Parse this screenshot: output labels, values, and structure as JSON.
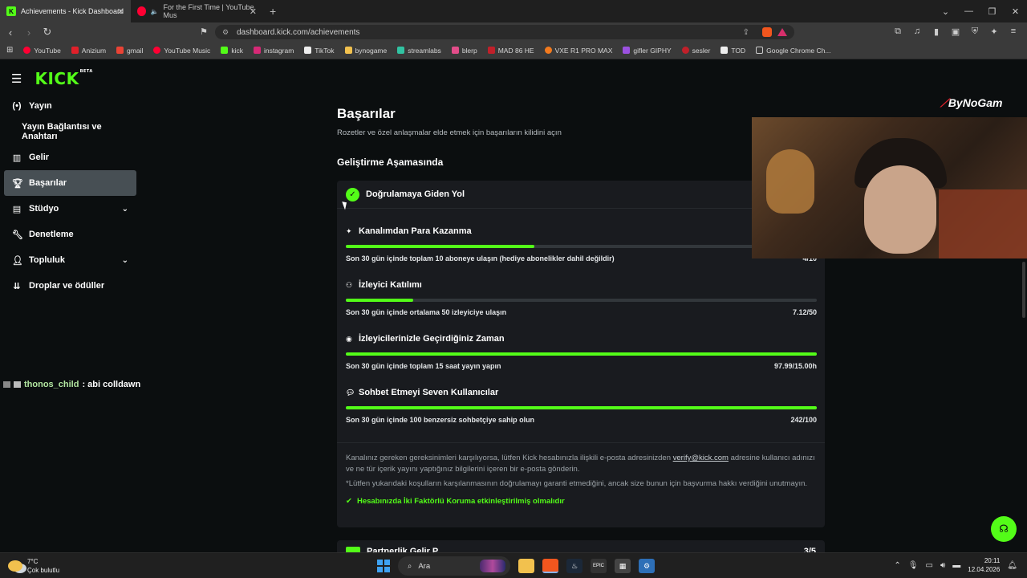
{
  "browser": {
    "tabs": [
      {
        "title": "Achievements - Kick Dashboard",
        "active": true
      },
      {
        "title": "For the First Time | YouTube Mus",
        "active": false
      }
    ],
    "new_tab": "+",
    "url": "dashboard.kick.com/achievements",
    "bookmarks": [
      {
        "label": "YouTube",
        "color": "#ff0033"
      },
      {
        "label": "Anizium",
        "color": "#e0202a"
      },
      {
        "label": "gmail",
        "color": "#ea4335"
      },
      {
        "label": "YouTube Music",
        "color": "#ff0033"
      },
      {
        "label": "kick",
        "color": "#53fc18"
      },
      {
        "label": "instagram",
        "color": "#d62976"
      },
      {
        "label": "TikTok",
        "color": "#ffffff"
      },
      {
        "label": "bynogame",
        "color": "#f2c14e"
      },
      {
        "label": "streamlabs",
        "color": "#31c3a2"
      },
      {
        "label": "blerp",
        "color": "#e34d8a"
      },
      {
        "label": "MAD 86 HE",
        "color": "#c0202a"
      },
      {
        "label": "VXE R1 PRO MAX",
        "color": "#f27a1e"
      },
      {
        "label": "gifler GIPHY",
        "color": "#9b51e0"
      },
      {
        "label": "sesler",
        "color": "#c0202a"
      },
      {
        "label": "TOD",
        "color": "#ffffff"
      },
      {
        "label": "Google Chrome Ch...",
        "color": "#888888"
      }
    ]
  },
  "kick": {
    "logo": "KICK",
    "logo_sup": "BETA",
    "accent": "#53fc18"
  },
  "sidebar": {
    "items": [
      {
        "label": "Yayın",
        "icon": "broadcast-icon",
        "type": "main"
      },
      {
        "label": "Yayın Bağlantısı ve Anahtarı",
        "icon": "",
        "type": "sub"
      },
      {
        "label": "Gelir",
        "icon": "revenue-icon",
        "type": "main"
      },
      {
        "label": "Başarılar",
        "icon": "trophy-icon",
        "type": "main",
        "active": true
      },
      {
        "label": "Stüdyo",
        "icon": "studio-icon",
        "type": "main",
        "expandable": true
      },
      {
        "label": "Denetleme",
        "icon": "wrench-icon",
        "type": "main"
      },
      {
        "label": "Topluluk",
        "icon": "community-icon",
        "type": "main",
        "expandable": true
      },
      {
        "label": "Droplar ve ödüller",
        "icon": "drops-icon",
        "type": "main"
      }
    ]
  },
  "chat_overlay": {
    "user": "thonos_child",
    "message": " : abi colldawn"
  },
  "main": {
    "title": "Başarılar",
    "subtitle": "Rozetler ve özel anlaşmalar elde etmek için başarıların kilidini açın",
    "section": "Geliştirme Aşamasında",
    "card": {
      "title": "Doğrulamaya Giden Yol",
      "requirements": [
        {
          "title": "Kanalımdan Para Kazanma",
          "icon": "sparkle-icon",
          "desc": "Son 30 gün içinde toplam 10 aboneye ulaşın (hediye abonelikler dahil değildir)",
          "value": "4/10",
          "progress": 0.4
        },
        {
          "title": "İzleyici Katılımı",
          "icon": "viewers-icon",
          "desc": "Son 30 gün içinde ortalama 50 izleyiciye ulaşın",
          "value": "7.12/50",
          "progress": 0.1424
        },
        {
          "title": "İzleyicilerinizle Geçirdiğiniz Zaman",
          "icon": "signal-icon",
          "desc": "Son 30 gün içinde toplam 15 saat yayın yapın",
          "value": "97.99/15.00h",
          "progress": 1.0
        },
        {
          "title": "Sohbet Etmeyi Seven Kullanıcılar",
          "icon": "chat-bubble-icon",
          "desc": "Son 30 gün içinde 100 benzersiz sohbetçiye sahip olun",
          "value": "242/100",
          "progress": 1.0
        }
      ],
      "footer_text_1": "Kanalınız gereken gereksinimleri karşılıyorsa, lütfen Kick hesabınızla ilişkili e-posta adresinizden ",
      "footer_link": "verify@kick.com",
      "footer_text_2": " adresine kullanıcı adınızı ve ne tür içerik yayını yaptığınız bilgilerini içeren bir e-posta gönderin.",
      "footer_note": "*Lütfen yukarıdaki koşulların karşılanmasının doğrulamayı garanti etmediğini, ancak size bunun için başvurma hakkı verdiğini unutmayın.",
      "twofa": "Hesabınızda İki Faktörlü Koruma etkinleştirilmiş olmalıdır"
    },
    "card2": {
      "title": "Partnerlik Gelir P...",
      "count": "3/5"
    }
  },
  "overlay": {
    "streamer_logo_mark": "⟋",
    "streamer_logo": "ByNoGam"
  },
  "taskbar": {
    "weather_temp": "7°C",
    "weather_desc": "Çok bulutlu",
    "search": "Ara",
    "time": "20:11",
    "date": "12.04.2026"
  }
}
